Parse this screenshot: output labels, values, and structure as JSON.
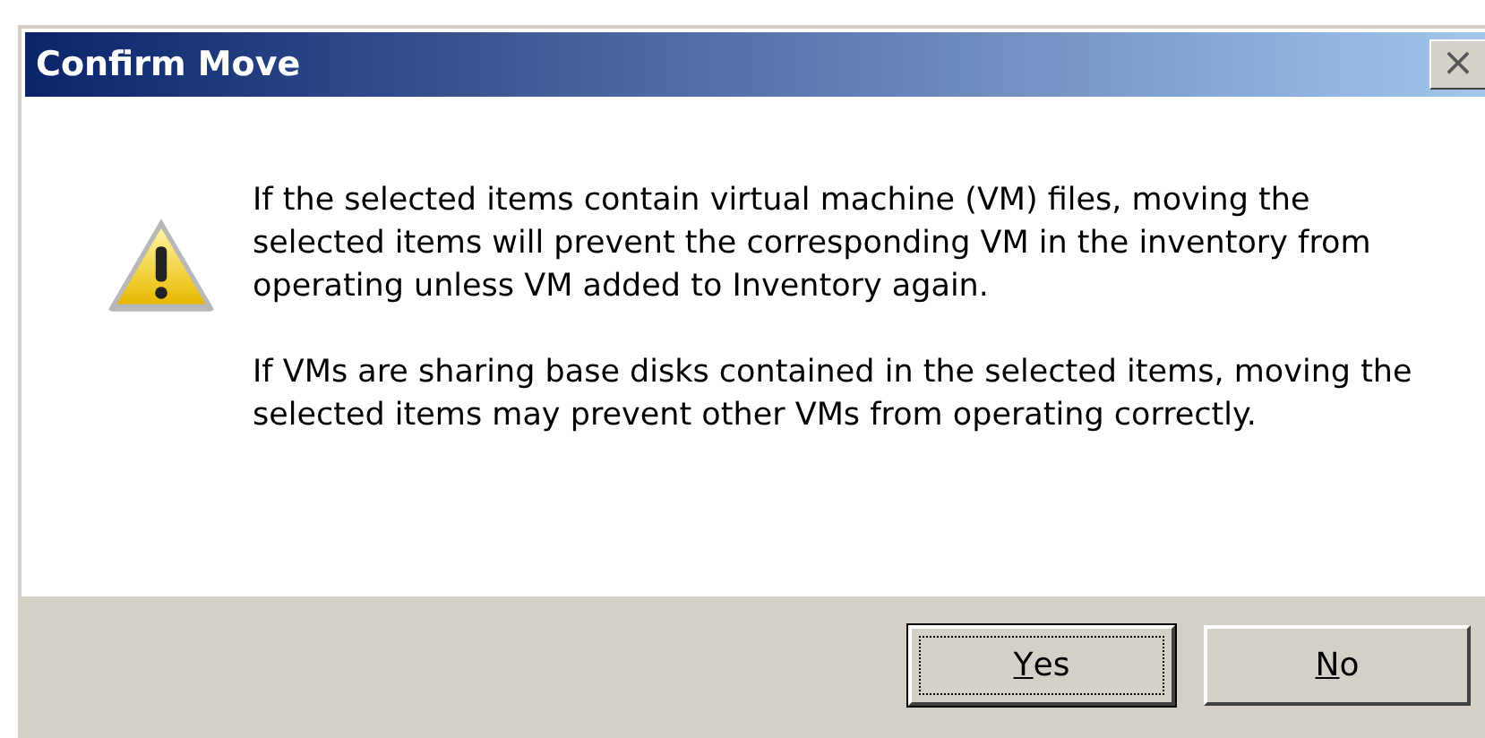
{
  "window": {
    "title": "Confirm Move",
    "close": "×"
  },
  "message": {
    "paragraphs": [
      "If the selected items contain virtual machine (VM) files, moving the selected items will prevent the corresponding VM in the inventory from operating unless VM added to Inventory again.",
      "If VMs are sharing base disks contained in the selected items, moving the selected items may prevent other VMs from operating correctly."
    ]
  },
  "buttons": [
    {
      "label": "Yes",
      "underline_first": true,
      "default": true
    },
    {
      "label": "No",
      "underline_first": true,
      "default": false
    }
  ]
}
